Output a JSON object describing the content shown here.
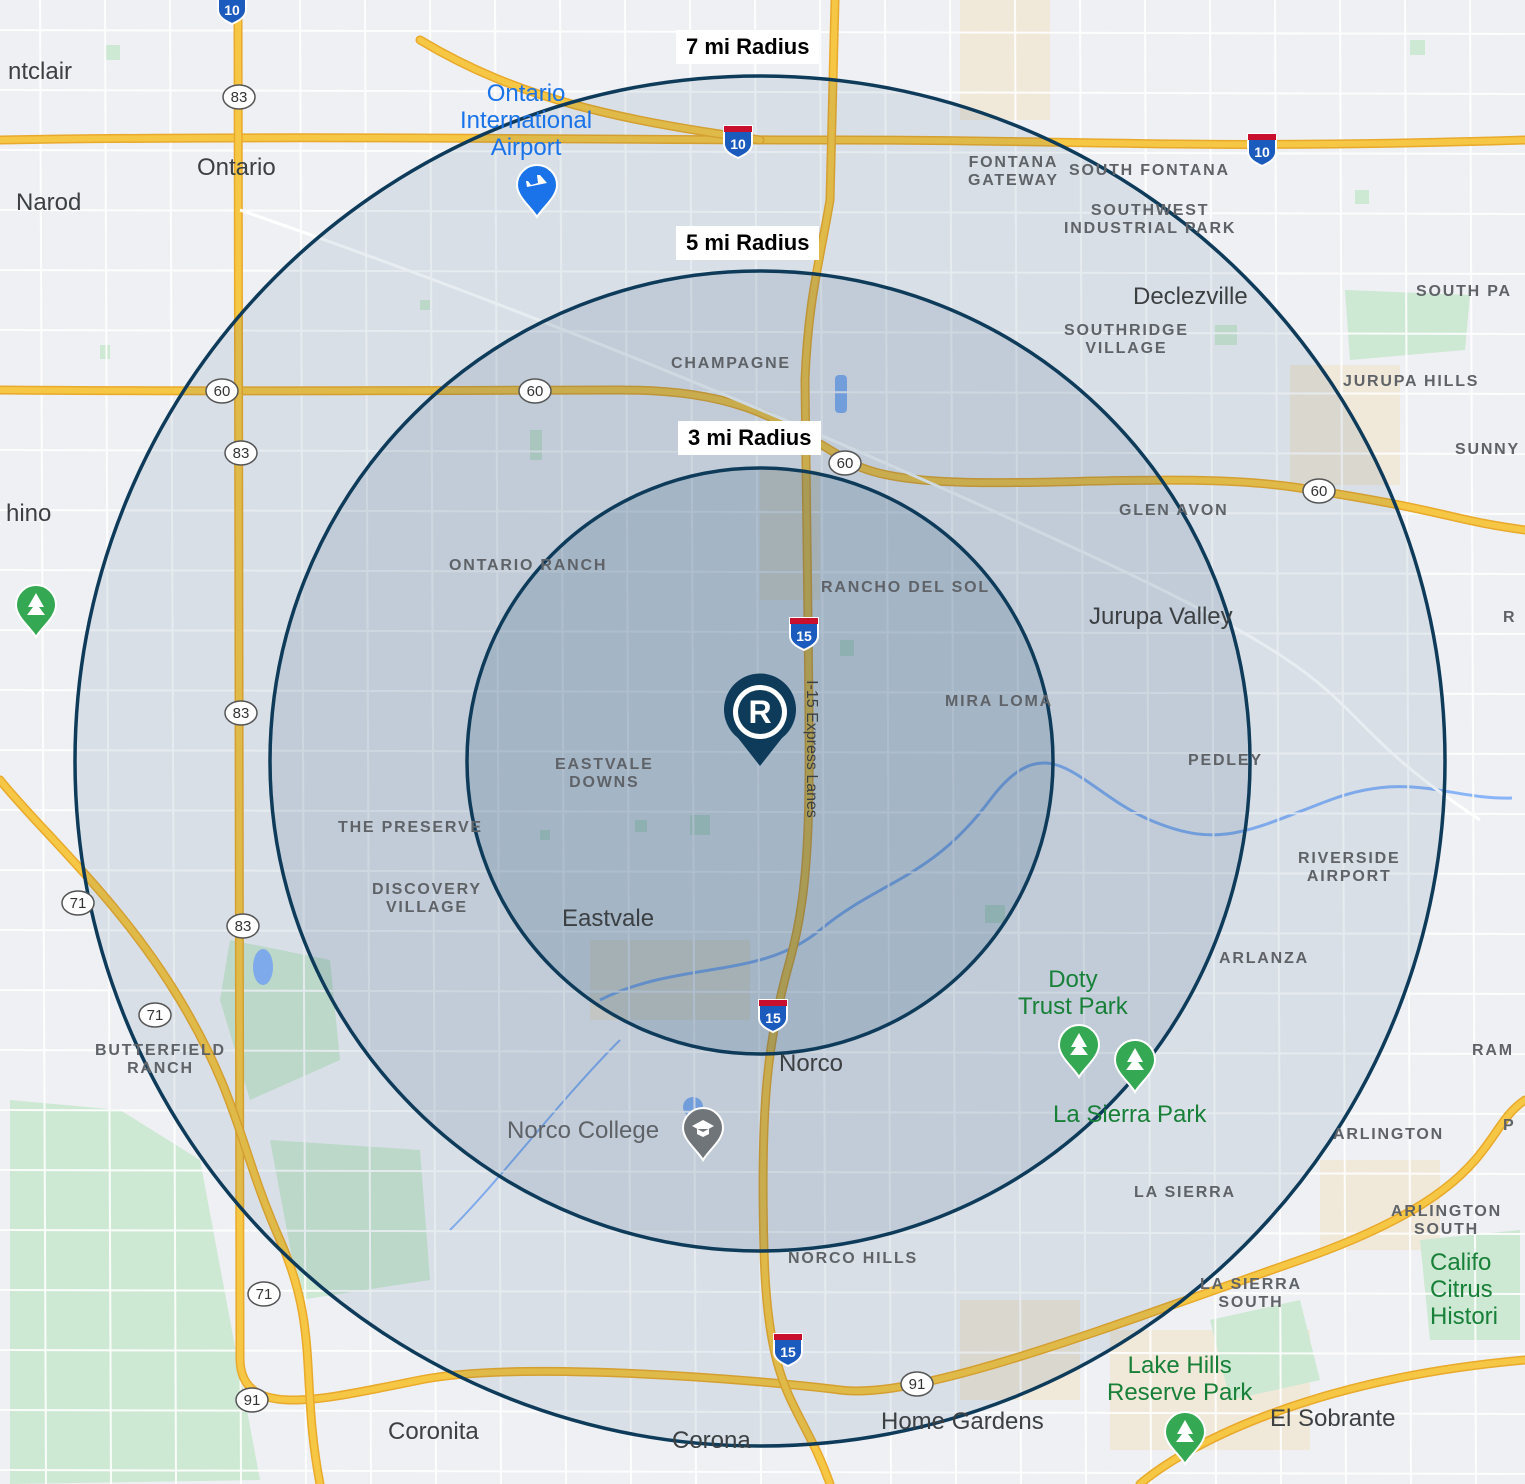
{
  "map": {
    "colors": {
      "land": "#eef0f3",
      "park": "#cde8d3",
      "urban": "#efe7d6",
      "water": "#8ab4f8",
      "highway": "#f6c744",
      "highway_edge": "#e9a92a",
      "radius_stroke": "#0e3b5a",
      "radius_fill": "#1f4e72"
    },
    "radius_labels": [
      "7 mi Radius",
      "5 mi Radius",
      "3 mi Radius"
    ],
    "cities": [
      "ntclair",
      "Ontario",
      "Narod",
      "hino",
      "Eastvale",
      "Norco",
      "Jurupa Valley",
      "Declezville",
      "Coronita",
      "Corona",
      "Home Gardens",
      "El Sobrante"
    ],
    "neighborhoods": [
      "CHAMPAGNE",
      "ONTARIO RANCH",
      "RANCHO DEL SOL",
      "MIRA LOMA",
      "EASTVALE\nDOWNS",
      "THE PRESERVE",
      "DISCOVERY\nVILLAGE",
      "PEDLEY",
      "GLEN AVON",
      "SOUTHRIDGE\nVILLAGE",
      "FONTANA\nGATEWAY",
      "SOUTH FONTANA",
      "SOUTHWEST\nINDUSTRIAL PARK",
      "SOUTH PA",
      "JURUPA HILLS",
      "SUNNY",
      "RIVERSIDE\nAIRPORT",
      "ARLANZA",
      "RAM",
      "ARLINGTON",
      "LA SIERRA",
      "ARLINGTON\nSOUTH",
      "LA SIERRA\nSOUTH",
      "NORCO HILLS",
      "BUTTERFIELD\nRANCH",
      "R",
      "P"
    ],
    "pois": {
      "airport": "Ontario\nInternational\nAirport",
      "college": "Norco College",
      "doty_park": "Doty\nTrust Park",
      "la_sierra_park": "La Sierra Park",
      "lake_hills_park": "Lake Hills\nReserve Park",
      "citrus": "Califo\nCitrus\nHistori"
    },
    "road_label": "I-15 Express Lanes",
    "highway_shields": {
      "interstate": [
        "10",
        "10",
        "10",
        "15",
        "15",
        "15"
      ],
      "state": [
        "83",
        "83",
        "83",
        "83",
        "60",
        "60",
        "60",
        "60",
        "71",
        "71",
        "71",
        "91",
        "91"
      ]
    },
    "icons": [
      "airport-icon",
      "tree-icon",
      "graduation-cap-icon",
      "location-pin-r-icon"
    ],
    "center_marker_letter": "R"
  }
}
